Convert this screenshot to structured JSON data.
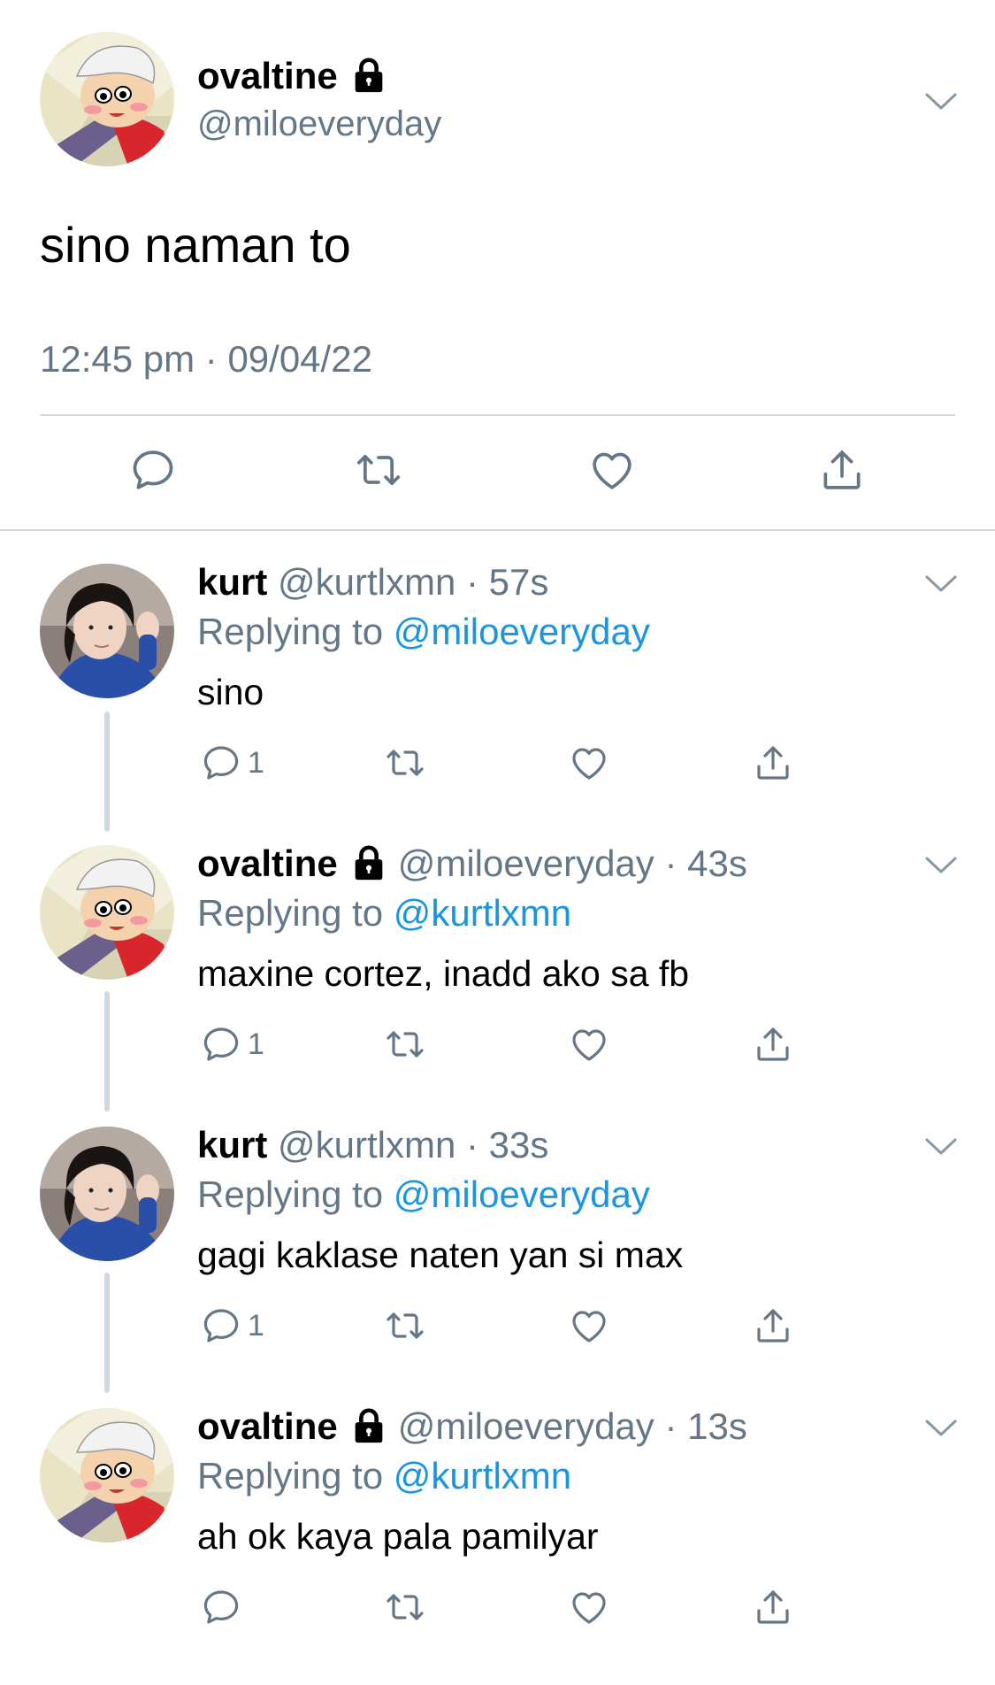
{
  "main_tweet": {
    "display_name": "ovaltine",
    "handle": "@miloeveryday",
    "text": "sino naman to",
    "timestamp": "12:45 pm · 09/04/22",
    "protected_icon": "lock-icon",
    "actions": [
      "reply-icon",
      "retweet-icon",
      "like-icon",
      "share-icon"
    ]
  },
  "replies": [
    {
      "display_name": "kurt",
      "handle": "@kurtlxmn",
      "time": "· 57s",
      "replying_prefix": "Replying to ",
      "replying_to": "@miloeveryday",
      "text": "sino",
      "reply_count": "1",
      "protected": false
    },
    {
      "display_name": "ovaltine",
      "handle": "@miloeveryday",
      "time": "· 43s",
      "replying_prefix": "Replying to ",
      "replying_to": "@kurtlxmn",
      "text": "maxine cortez, inadd ako sa fb",
      "reply_count": "1",
      "protected": true
    },
    {
      "display_name": "kurt",
      "handle": "@kurtlxmn",
      "time": "· 33s",
      "replying_prefix": "Replying to ",
      "replying_to": "@miloeveryday",
      "text": "gagi kaklase naten yan si max",
      "reply_count": "1",
      "protected": false
    },
    {
      "display_name": "ovaltine",
      "handle": "@miloeveryday",
      "time": "· 13s",
      "replying_prefix": "Replying to ",
      "replying_to": "@kurtlxmn",
      "text": "ah ok kaya pala pamilyar",
      "reply_count": "",
      "protected": true
    }
  ],
  "colors": {
    "text": "#000000",
    "secondary": "#657786",
    "link": "#1b95e0",
    "divider": "#d5dbe0"
  }
}
